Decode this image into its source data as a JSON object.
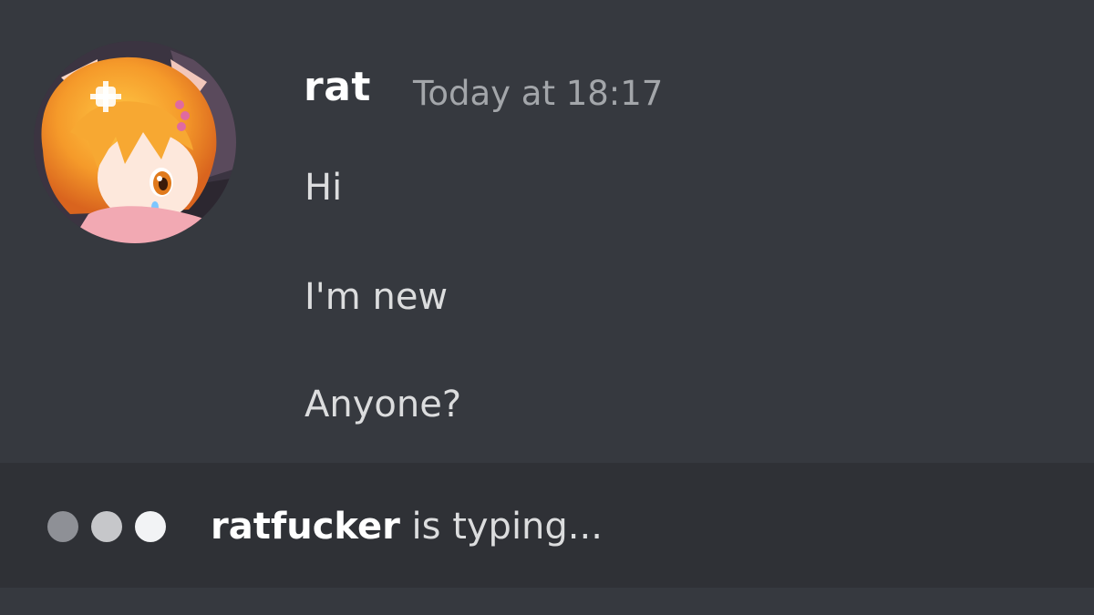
{
  "message": {
    "author": "rat",
    "timestamp": "Today at 18:17",
    "lines": [
      "Hi",
      "I'm new",
      "Anyone?"
    ]
  },
  "typing": {
    "user": "ratfucker",
    "suffix": " is typing..."
  },
  "avatar": {
    "icon": "anime-girl-avatar-icon"
  },
  "colors": {
    "background": "#36393f",
    "typing_bar": "#2f3136",
    "username": "#ffffff",
    "timestamp": "#a3a6aa",
    "message_text": "#dcddde"
  }
}
